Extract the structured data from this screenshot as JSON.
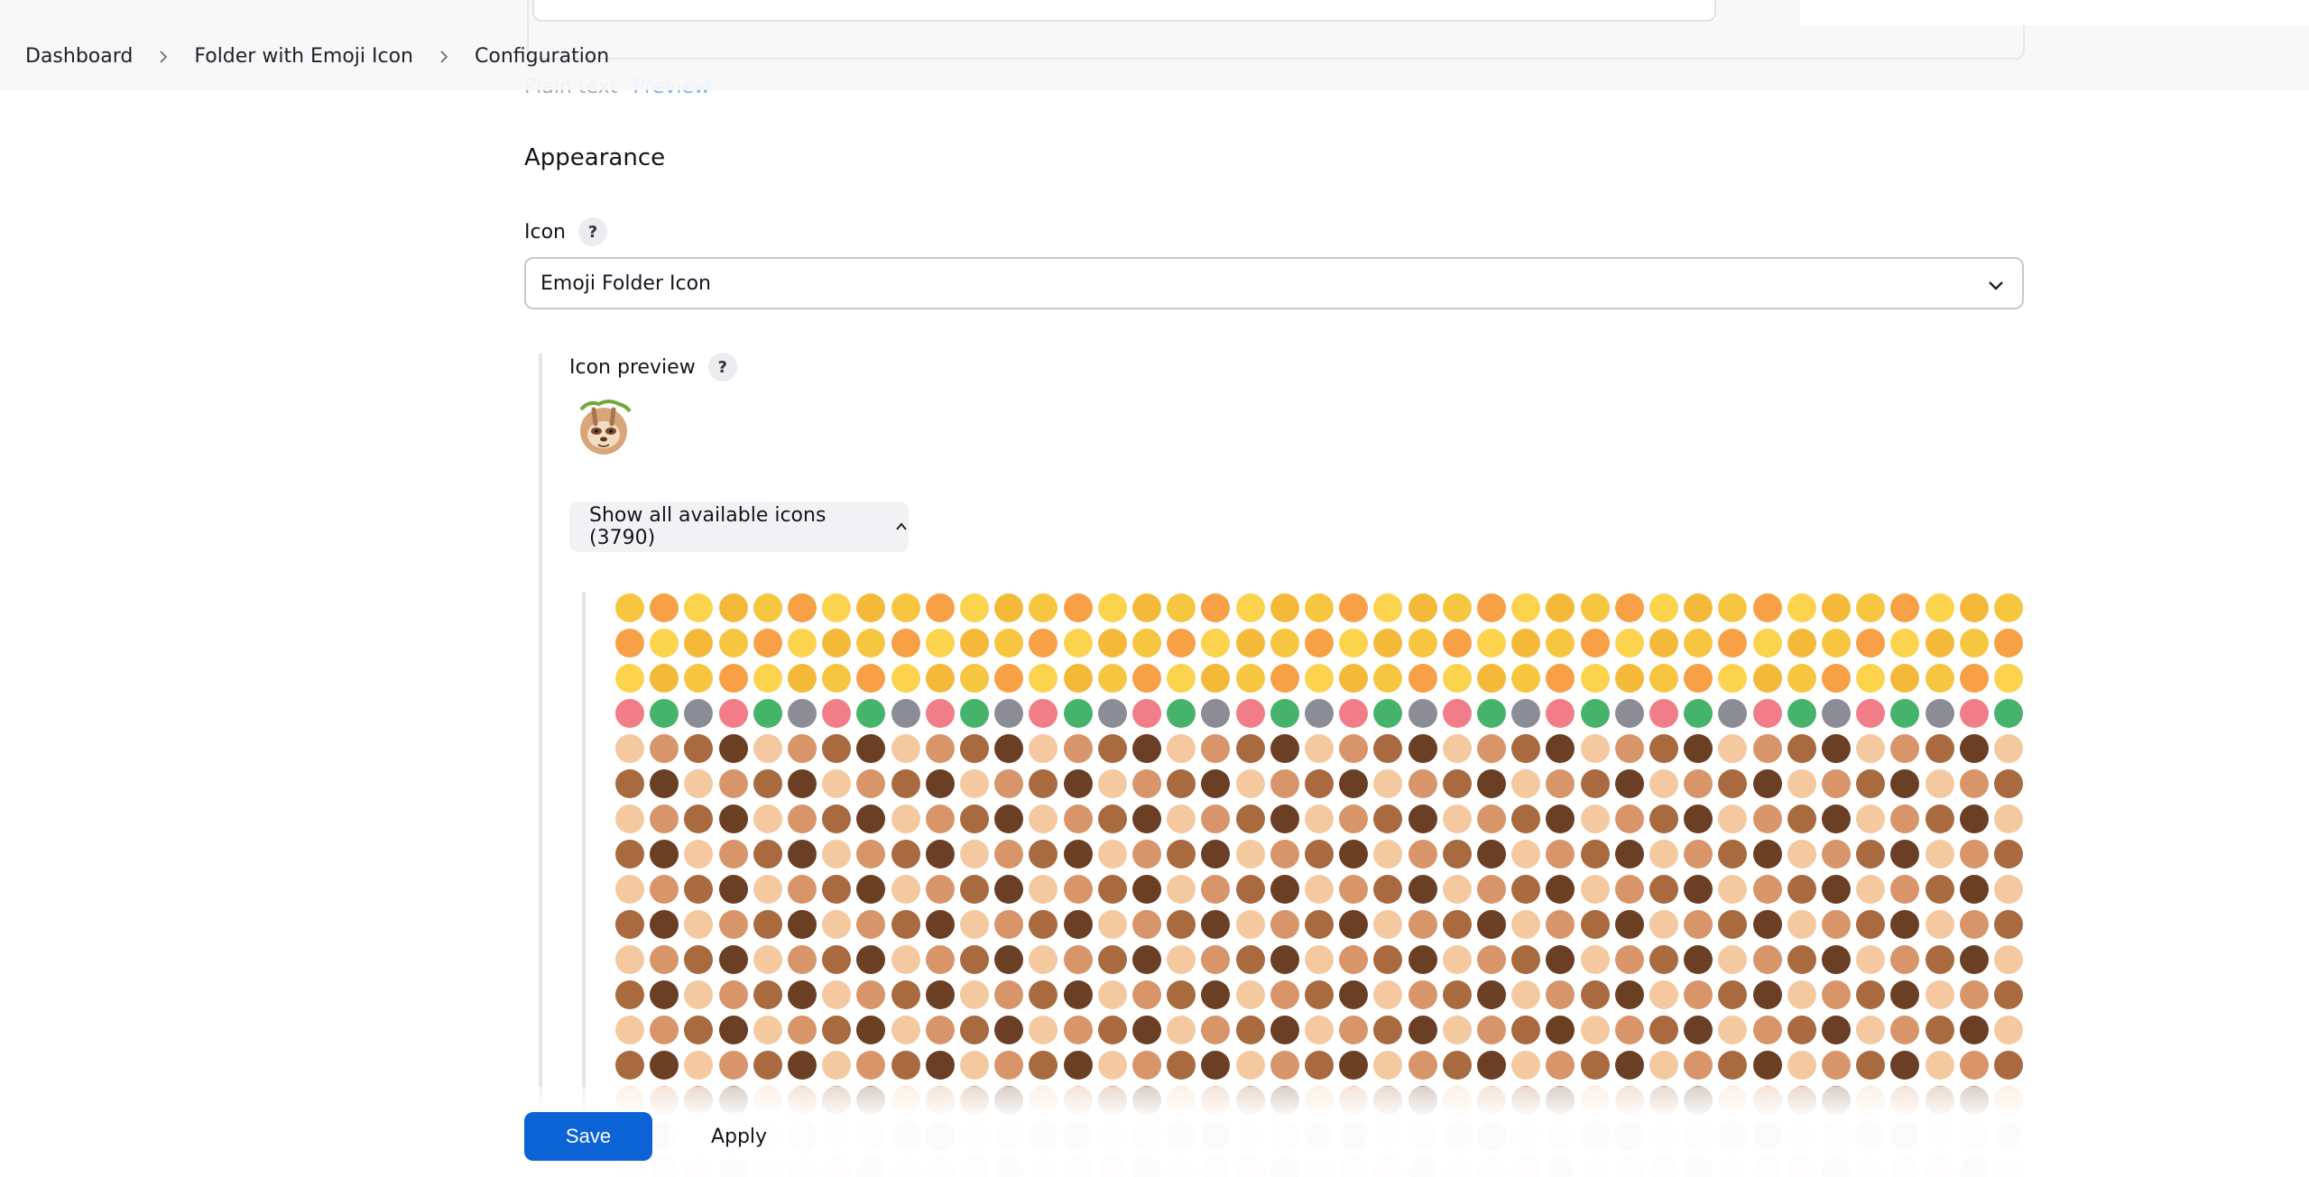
{
  "breadcrumb": {
    "items": [
      "Dashboard",
      "Folder with Emoji Icon",
      "Configuration"
    ]
  },
  "description": {
    "tab_plain": "Plain text",
    "tab_preview": "Preview"
  },
  "appearance": {
    "section_title": "Appearance",
    "icon_label": "Icon",
    "help_glyph": "?",
    "icon_select_value": "Emoji Folder Icon",
    "preview_label": "Icon preview",
    "preview_icon": "sloth-emoji",
    "show_all_label": "Show all available icons (3790)",
    "emoji_palette": [
      "#f7c640",
      "#f5b93a",
      "#fcd34d",
      "#f8a046",
      "#e9b0ff",
      "#f4c9a0",
      "#d8956a",
      "#a86a3e",
      "#6b3f24",
      "#f17d88",
      "#e23c4a",
      "#ff9c3a",
      "#46b36b",
      "#3c8ef0",
      "#9c5ce6",
      "#8c8c96",
      "#e6e6ea",
      "#caa66f"
    ]
  },
  "actions": {
    "save_label": "Save",
    "apply_label": "Apply"
  }
}
